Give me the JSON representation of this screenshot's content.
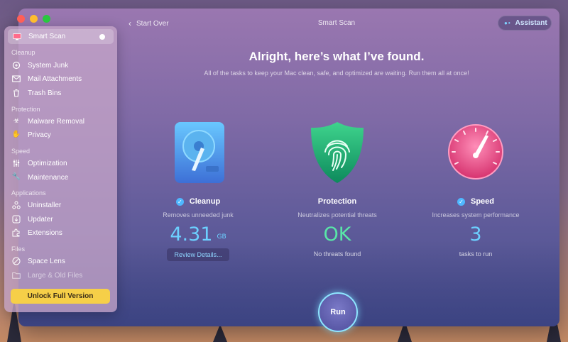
{
  "sidebar": {
    "smart_scan": "Smart Scan",
    "sections": {
      "cleanup": "Cleanup",
      "protection": "Protection",
      "speed": "Speed",
      "applications": "Applications",
      "files": "Files"
    },
    "items": {
      "system_junk": "System Junk",
      "mail_attachments": "Mail Attachments",
      "trash_bins": "Trash Bins",
      "malware_removal": "Malware Removal",
      "privacy": "Privacy",
      "optimization": "Optimization",
      "maintenance": "Maintenance",
      "uninstaller": "Uninstaller",
      "updater": "Updater",
      "extensions": "Extensions",
      "space_lens": "Space Lens",
      "large_old_files": "Large & Old Files"
    },
    "unlock_label": "Unlock Full Version"
  },
  "toolbar": {
    "back_label": "Start Over",
    "title": "Smart Scan",
    "assistant_label": "Assistant"
  },
  "main": {
    "headline": "Alright, here’s what I’ve found.",
    "subline": "All of the tasks to keep your Mac clean, safe, and optimized are waiting. Run them all at once!",
    "cards": {
      "cleanup": {
        "title": "Cleanup",
        "description": "Removes unneeded junk",
        "value": "4.31",
        "unit": "GB",
        "action_label": "Review Details..."
      },
      "protection": {
        "title": "Protection",
        "description": "Neutralizes potential threats",
        "value": "OK",
        "footnote": "No threats found"
      },
      "speed": {
        "title": "Speed",
        "description": "Increases system performance",
        "value": "3",
        "footnote": "tasks to run"
      }
    },
    "run_label": "Run"
  },
  "colors": {
    "accent_blue": "#6cd0ff",
    "ok_green": "#59e6a8",
    "unlock_yellow": "#f6cf48"
  }
}
